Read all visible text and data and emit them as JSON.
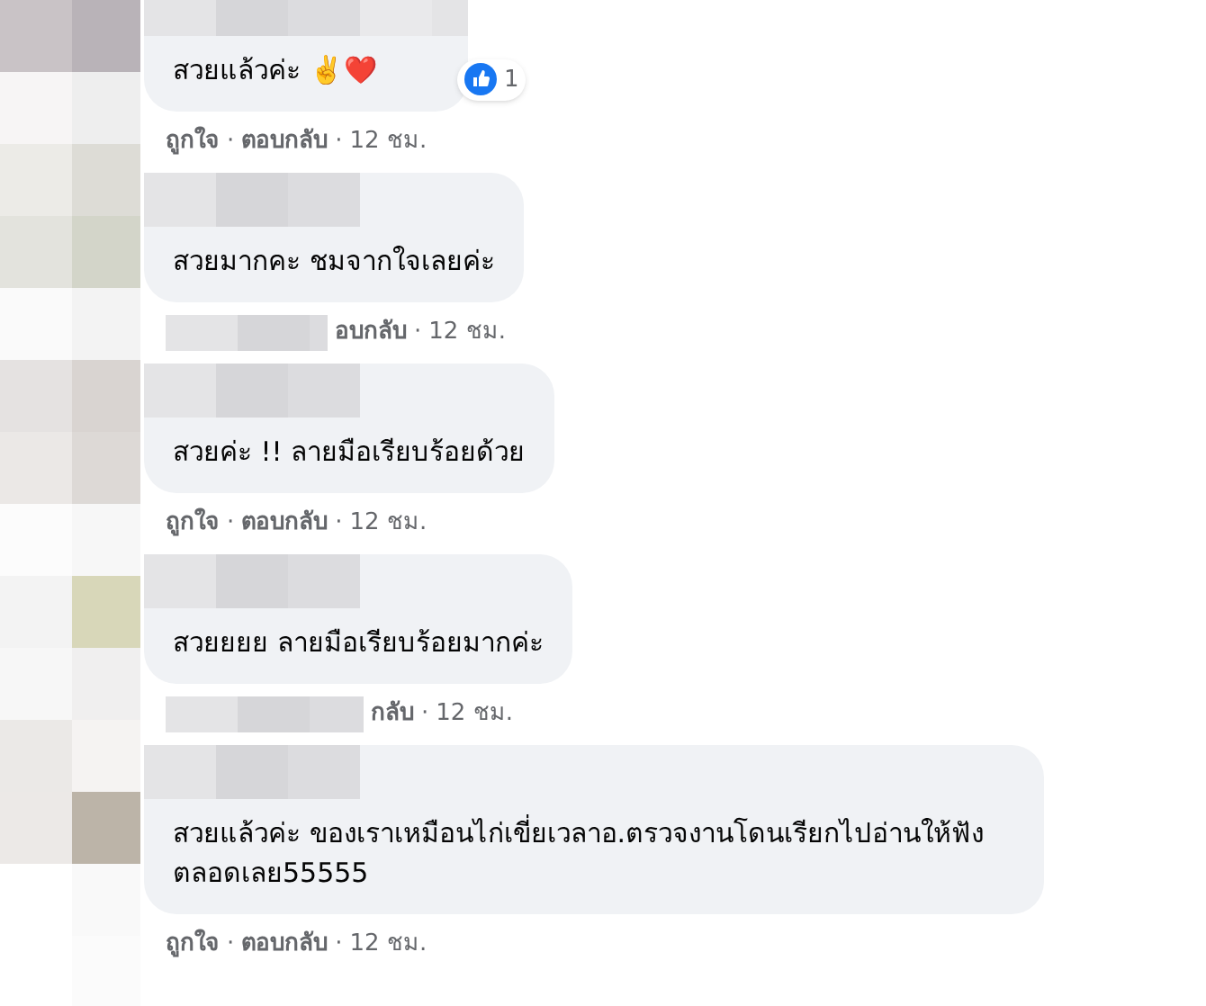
{
  "separator": "·",
  "comments": [
    {
      "text": "สวยแล้วค่ะ ✌️❤️",
      "reactions": {
        "count": "1"
      },
      "actions": {
        "covered": false,
        "like": "ถูกใจ",
        "reply": "ตอบกลับ",
        "time": "12 ชม."
      }
    },
    {
      "text": "สวยมากคะ ชมจากใจเลยค่ะ",
      "actions": {
        "covered": true,
        "reply": "อบกลับ",
        "time": "12 ชม."
      }
    },
    {
      "text": "สวยค่ะ !! ลายมือเรียบร้อยด้วย",
      "actions": {
        "covered": false,
        "like": "ถูกใจ",
        "reply": "ตอบกลับ",
        "time": "12 ชม."
      }
    },
    {
      "text": "สวยยยย ลายมือเรียบร้อยมากค่ะ",
      "actions": {
        "covered": true,
        "reply": "กลับ",
        "time": "12 ชม."
      }
    },
    {
      "text": "สวยแล้วค่ะ ของเราเหมือนไก่เขี่ยเวลาอ.ตรวจงานโดนเรียกไปอ่านให้ฟังตลอดเลย55555",
      "actions": {
        "covered": false,
        "like": "ถูกใจ",
        "reply": "ตอบกลับ",
        "time": "12 ชม."
      }
    }
  ]
}
